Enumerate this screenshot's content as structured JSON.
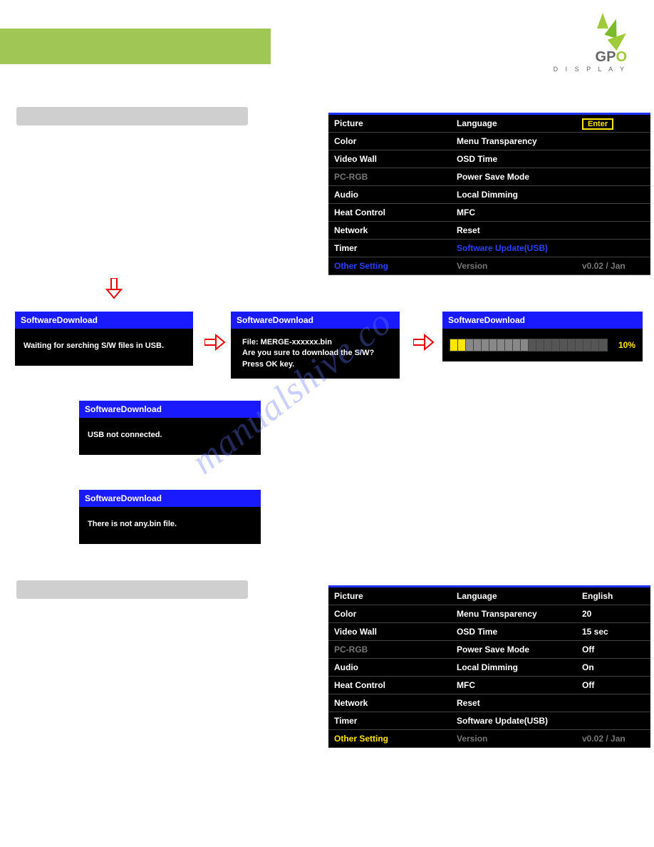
{
  "logo": {
    "brand_g": "G",
    "brand_p": "P",
    "brand_o": "O",
    "sub": "D I S P L A Y"
  },
  "menu1": {
    "rows": [
      {
        "c1": "Picture",
        "c2": "Language",
        "c3": "Enter",
        "c3_enter": true
      },
      {
        "c1": "Color",
        "c2": "Menu Transparency",
        "c3": ""
      },
      {
        "c1": "Video Wall",
        "c2": "OSD Time",
        "c3": ""
      },
      {
        "c1": "PC-RGB",
        "c2": "Power Save Mode",
        "c3": "",
        "c1_dim": true
      },
      {
        "c1": "Audio",
        "c2": "Local Dimming",
        "c3": ""
      },
      {
        "c1": "Heat Control",
        "c2": "MFC",
        "c3": ""
      },
      {
        "c1": "Network",
        "c2": "Reset",
        "c3": ""
      },
      {
        "c1": "Timer",
        "c2": "Software Update(USB)",
        "c3": "",
        "c2_blue": true
      },
      {
        "c1": "Other Setting",
        "c2": "Version",
        "c3": "v0.02 / Jan",
        "c1_blue": true,
        "c2_dim": true,
        "c3_dim": true
      }
    ]
  },
  "menu2": {
    "rows": [
      {
        "c1": "Picture",
        "c2": "Language",
        "c3": "English"
      },
      {
        "c1": "Color",
        "c2": "Menu Transparency",
        "c3": "20"
      },
      {
        "c1": "Video Wall",
        "c2": "OSD Time",
        "c3": "15 sec"
      },
      {
        "c1": "PC-RGB",
        "c2": "Power Save Mode",
        "c3": "Off",
        "c1_dim": true
      },
      {
        "c1": "Audio",
        "c2": "Local Dimming",
        "c3": "On"
      },
      {
        "c1": "Heat Control",
        "c2": "MFC",
        "c3": "Off"
      },
      {
        "c1": "Network",
        "c2": "Reset",
        "c3": ""
      },
      {
        "c1": "Timer",
        "c2": "Software Update(USB)",
        "c3": ""
      },
      {
        "c1": "Other Setting",
        "c2": "Version",
        "c3": "v0.02 / Jan",
        "c1_yellow": true,
        "c2_dim": true,
        "c3_dim": true
      }
    ]
  },
  "dialogs": {
    "title": "SoftwareDownload",
    "d1_body": "Waiting for serching S/W files in USB.",
    "d2_line1": "File: MERGE-xxxxxx.bin",
    "d2_line2": "Are you sure to download the S/W?",
    "d2_line3": "Press OK key.",
    "d3_pct": "10%",
    "d4_body": "USB not connected.",
    "d5_body": "There is not any.bin file."
  },
  "watermark": "manualshive.co"
}
